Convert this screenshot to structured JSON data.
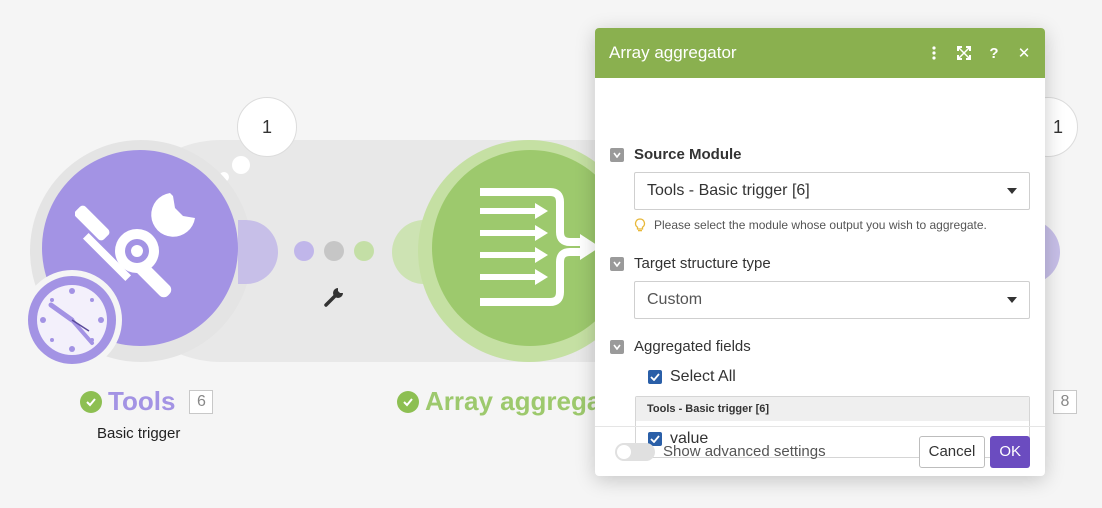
{
  "canvas": {
    "tools_module": {
      "name": "Tools",
      "id": "6",
      "subtitle": "Basic trigger",
      "bubble_count": "1"
    },
    "aggregator_module": {
      "name": "Array aggrega"
    },
    "right_module": {
      "bubble_count": "1",
      "id": "8"
    },
    "icons": [
      "tools-icon",
      "clock-icon",
      "array-aggregator-icon",
      "wrench-icon",
      "check-icon"
    ],
    "colors": {
      "tools": "#a393e4",
      "aggregator": "#9dc96d",
      "status_ok": "#8dbf52"
    }
  },
  "dialog": {
    "title": "Array aggregator",
    "header_icons": [
      "more-icon",
      "expand-icon",
      "help-icon",
      "close-icon"
    ],
    "source_module": {
      "label": "Source Module",
      "value": "Tools - Basic trigger [6]",
      "hint": "Please select the module whose output you wish to aggregate."
    },
    "target_structure": {
      "label": "Target structure type",
      "value": "Custom"
    },
    "aggregated_fields": {
      "label": "Aggregated fields",
      "select_all": "Select All",
      "group_header": "Tools - Basic trigger [6]",
      "items": [
        "value"
      ]
    },
    "footer": {
      "advanced_label": "Show advanced settings",
      "cancel": "Cancel",
      "ok": "OK"
    },
    "colors": {
      "header": "#8ab04f",
      "ok_button": "#6b4cc0",
      "checkbox": "#2a5fa8"
    }
  }
}
